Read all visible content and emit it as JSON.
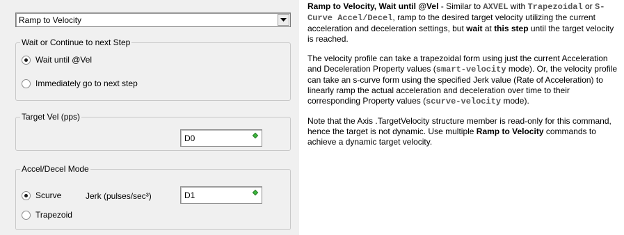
{
  "mode_select": {
    "selected": "Ramp to Velocity"
  },
  "wait_group": {
    "title": "Wait or Continue to next Step",
    "options": [
      {
        "label": "Wait until @Vel",
        "selected": true
      },
      {
        "label": "Immediately go to next step",
        "selected": false
      }
    ]
  },
  "target_group": {
    "title": "Target Vel (pps)",
    "value": "D0"
  },
  "accel_group": {
    "title": "Accel/Decel Mode",
    "options": [
      {
        "label": "Scurve",
        "selected": true
      },
      {
        "label": "Trapezoid",
        "selected": false
      }
    ],
    "jerk_label": "Jerk (pulses/sec³)",
    "jerk_value": "D1"
  },
  "help": {
    "p1": {
      "title": "Ramp to Velocity, Wait until @Vel",
      "t1": " - Similar to ",
      "code1": "AXVEL",
      "t2": " with ",
      "code2": "Trapezoidal",
      "t3": " or ",
      "code3": "S-Curve Accel/Decel",
      "t4": ", ramp to the desired target velocity utilizing the current acceleration and deceleration settings, but ",
      "b1": "wait",
      "t5": " at ",
      "b2": "this step",
      "t6": " until the target velocity is reached."
    },
    "p2": {
      "t1": "The velocity profile can take a trapezoidal form using just the current Acceleration and Deceleration Property values (",
      "code1": "smart-velocity",
      "t2": " mode). Or, the velocity profile can take an s-curve form using the specified Jerk value (Rate of Acceleration) to linearly ramp the actual acceleration and deceleration over time to their corresponding Property values (",
      "code2": "scurve-velocity",
      "t3": " mode)."
    },
    "p3": {
      "t1": "Note that the Axis .TargetVelocity structure member is read-only for this command, hence the target is not dynamic. Use multiple ",
      "b1": "Ramp to Velocity",
      "t2": " commands to achieve a dynamic target velocity."
    }
  },
  "colors": {
    "indicator": "#3cb83c",
    "panel_bg": "#f0f0f0"
  }
}
